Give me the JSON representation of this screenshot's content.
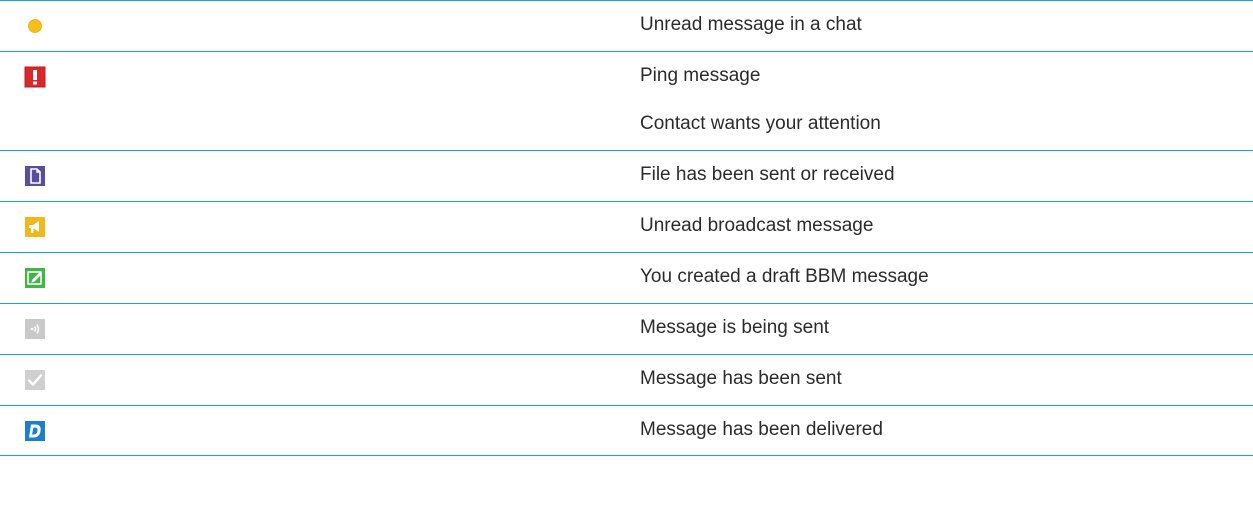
{
  "rows": [
    {
      "icon": "unread-dot-icon",
      "lines": [
        "Unread message in a chat"
      ]
    },
    {
      "icon": "ping-exclamation-icon",
      "lines": [
        "Ping message",
        "Contact wants your attention"
      ]
    },
    {
      "icon": "file-icon",
      "lines": [
        "File has been sent or received"
      ]
    },
    {
      "icon": "broadcast-megaphone-icon",
      "lines": [
        "Unread broadcast message"
      ]
    },
    {
      "icon": "draft-edit-icon",
      "lines": [
        "You created a draft BBM message"
      ]
    },
    {
      "icon": "sending-signal-icon",
      "lines": [
        "Message is being sent"
      ]
    },
    {
      "icon": "sent-checkmark-icon",
      "lines": [
        "Message has been sent"
      ]
    },
    {
      "icon": "delivered-d-icon",
      "lines": [
        "Message has been delivered"
      ]
    }
  ],
  "colors": {
    "rule": "#1aa1d6",
    "dot": "#f5c01a",
    "ping": "#d8282c",
    "file": "#5a4d9c",
    "broadcast": "#f0b81c",
    "draft": "#46b24a",
    "sending": "#b7b7b7",
    "sent": "#b9b9b9",
    "delivered": "#1e7fc8"
  }
}
